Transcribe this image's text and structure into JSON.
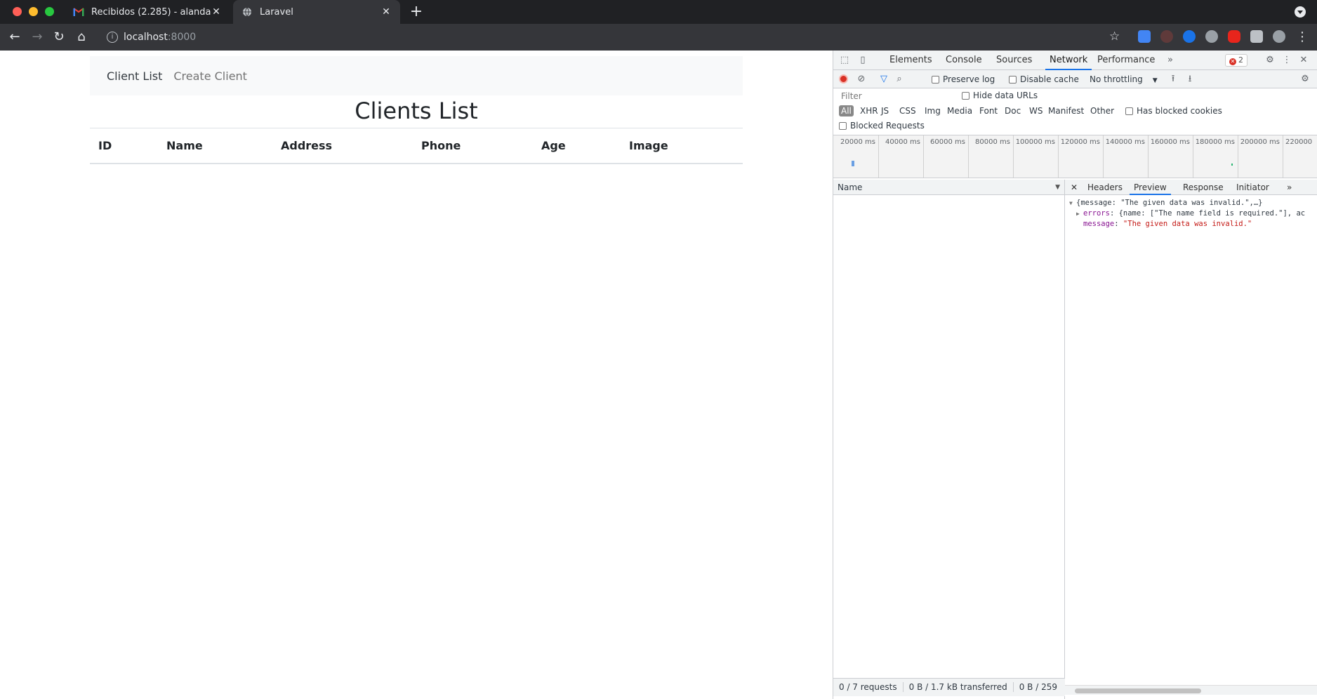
{
  "browser": {
    "tabs": [
      {
        "title": "Recibidos (2.285) - alandavidb",
        "favicon": "gmail-icon"
      },
      {
        "title": "Laravel",
        "favicon": "globe-icon"
      }
    ],
    "address": {
      "host": "localhost",
      "port": ":8000"
    }
  },
  "page": {
    "nav": {
      "client_list": "Client List",
      "create_client": "Create Client"
    },
    "title": "Clients List",
    "columns": [
      "ID",
      "Name",
      "Address",
      "Phone",
      "Age",
      "Image"
    ]
  },
  "devtools": {
    "tabs": [
      "Elements",
      "Console",
      "Sources",
      "Network",
      "Performance"
    ],
    "active_tab": "Network",
    "error_count": "2",
    "preserve_log": "Preserve log",
    "disable_cache": "Disable cache",
    "throttling": "No throttling",
    "filter_placeholder": "Filter",
    "hide_data_urls": "Hide data URLs",
    "types": [
      "All",
      "XHR",
      "JS",
      "CSS",
      "Img",
      "Media",
      "Font",
      "Doc",
      "WS",
      "Manifest",
      "Other"
    ],
    "has_blocked_cookies": "Has blocked cookies",
    "blocked_requests": "Blocked Requests",
    "timeline_labels": [
      "20000 ms",
      "40000 ms",
      "60000 ms",
      "80000 ms",
      "100000 ms",
      "120000 ms",
      "140000 ms",
      "160000 ms",
      "180000 ms",
      "200000 ms",
      "220000"
    ],
    "name_column": "Name",
    "status": {
      "requests": "0 / 7 requests",
      "transferred": "0 B / 1.7 kB transferred",
      "resources": "0 B / 259"
    },
    "preview_tabs": [
      "Headers",
      "Preview",
      "Response",
      "Initiator"
    ],
    "preview": {
      "summary": "{message: \"The given data was invalid.\",…}",
      "errors_key": "errors",
      "errors_value": "{name: [\"The name field is required.\"], ac",
      "message_key": "message",
      "message_value": "\"The given data was invalid.\""
    }
  }
}
